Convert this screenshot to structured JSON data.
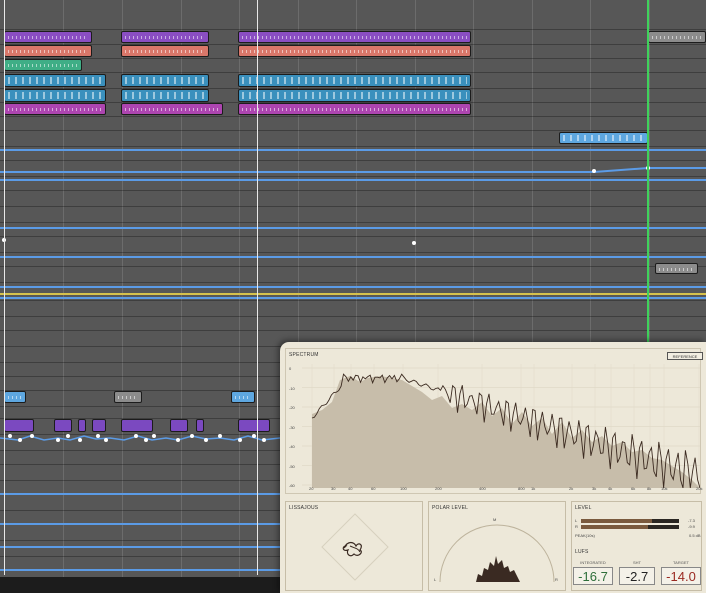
{
  "plugin": {
    "spectrum_title": "SPECTRUM",
    "reference_button": "REFERENCE",
    "y_ticks": [
      "0",
      "-10",
      "-20",
      "-30",
      "-40",
      "-50",
      "-60"
    ],
    "x_ticks": [
      "20",
      "30",
      "40",
      "60",
      "100",
      "200",
      "400",
      "800",
      "1k",
      "2k",
      "3k",
      "4k",
      "6k",
      "8k",
      "10k",
      "20k"
    ],
    "lissajous_title": "LISSAJOUS",
    "polar_title": "POLAR LEVEL",
    "polar_labels": {
      "m": "M",
      "l": "L",
      "r": "R"
    },
    "level_title": "LEVEL",
    "level_rows": [
      {
        "ch": "L",
        "val": "-7.3",
        "fraction": 0.72
      },
      {
        "ch": "R",
        "val": "-9.9",
        "fraction": 0.68
      }
    ],
    "peak_label": "PEAK(10s)",
    "peak_value": "0.5 dB",
    "lufs_title": "LUFS",
    "lufs": [
      {
        "label": "INTEGRATED",
        "value": "-16.7",
        "color": "#2e6e3a"
      },
      {
        "label": "SHT",
        "value": "-2.7",
        "color": "#222222"
      },
      {
        "label": "TARGET",
        "value": "-14.0",
        "color": "#9a2a22"
      }
    ]
  },
  "colors": {
    "automation": "#5b9be6",
    "playhead": "#3fd25b",
    "panel_bg": "#ede8d9"
  }
}
